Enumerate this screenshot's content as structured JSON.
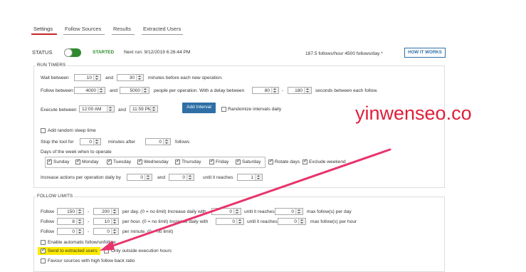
{
  "tabs": [
    "Settings",
    "Follow Sources",
    "Results",
    "Extracted Users"
  ],
  "status": {
    "label": "STATUS",
    "state": "STARTED",
    "next_run": "Next run: 9/12/2019 6:26:44 PM",
    "rate": "187.5 follows/hour   4500 follows/day *",
    "how_button": "HOW IT WORKS"
  },
  "run_timers": {
    "title": "RUN TIMERS",
    "wait_label": "Wait between",
    "wait_from": "10",
    "and1": "and",
    "wait_to": "30",
    "wait_suffix": "minutes before each new operation.",
    "follow_label": "Follow between",
    "follow_from": "4000",
    "and2": "and",
    "follow_to": "5000",
    "follow_suffix": "people per operation. With a delay between",
    "delay_from": "80",
    "dash": "-",
    "delay_to": "180",
    "delay_suffix": "seconds between each follow.",
    "execute_label": "Execute between",
    "exec_from": "12:00 AM",
    "and3": "and",
    "exec_to": "11:59 PM",
    "add_interval": "Add Interval",
    "randomize": "Randomize intervals daily",
    "random_sleep": "Add random sleep time",
    "stop_label": "Stop the tool for",
    "stop_minutes": "0",
    "stop_after_label": "minutes after",
    "stop_follows": "0",
    "follows_label": "follows",
    "days_label": "Days of the week when to operate",
    "days": [
      "Sunday",
      "Monday",
      "Tuesday",
      "Wednesday",
      "Thursday",
      "Friday",
      "Saturday"
    ],
    "rotate_days": "Rotate days",
    "exclude_weekend": "Exclude weekend",
    "increase_label": "Increase actions per operation daily by",
    "increase_value": "0",
    "and4": "and",
    "increase_to": "0",
    "until_label": "until it reaches",
    "until_value": "1"
  },
  "follow_limits": {
    "title": "FOLLOW LIMITS",
    "row1": {
      "label": "Follow",
      "from": "150",
      "dash": "-",
      "to": "200",
      "text": "per day. (0 = no limit) Increase daily with",
      "inc": "0",
      "until": "until it reaches",
      "max": "0",
      "max_text": "max follow(s) per day"
    },
    "row2": {
      "label": "Follow",
      "from": "8",
      "dash": "-",
      "to": "10",
      "text": "per hour. (0 = no limit) Increase daily with",
      "inc": "0",
      "until": "until it reaches",
      "max": "0",
      "max_text": "max follow(s) per hour"
    },
    "row3": {
      "label": "Follow",
      "from": "0",
      "dash": "-",
      "to": "0",
      "text": "per minute. (0 = no limit)"
    },
    "auto_follow": "Enable automatic follow/unfollow",
    "send_extracted": "Send to extracted users",
    "only_outside": "Only outside execution hours",
    "favour": "Favour sources with high follow back ratio"
  },
  "watermark": "yinwenseo.co",
  "colors": {
    "accent_red": "#c62828",
    "toggle_green": "#2e8b2e",
    "button_blue": "#2f6fa6",
    "arrow": "#e8336b",
    "highlight": "#ffeb00"
  }
}
